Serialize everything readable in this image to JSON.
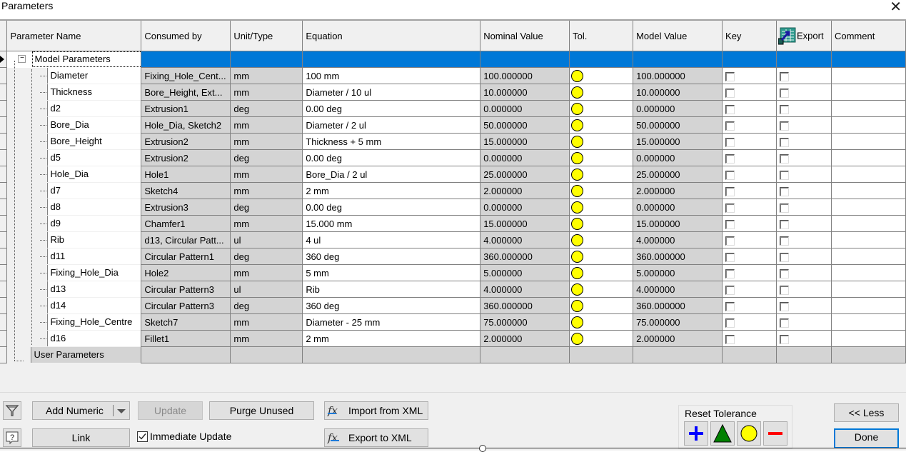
{
  "window": {
    "title": "Parameters",
    "close_icon": "close-icon"
  },
  "table": {
    "columns": [
      "Parameter Name",
      "Consumed by",
      "Unit/Type",
      "Equation",
      "Nominal Value",
      "Tol.",
      "Model Value",
      "Key",
      "Export",
      "Comment"
    ],
    "export_header_icon": "spreadsheet-export-icon",
    "groups": {
      "model": "Model Parameters",
      "user": "User Parameters"
    },
    "rows": [
      {
        "name": "Diameter",
        "consumed_by": "Fixing_Hole_Cent...",
        "unit": "mm",
        "equation": "100 mm",
        "nominal": "100.000000",
        "tol": "yellow-circle",
        "model": "100.000000",
        "key": false,
        "export": false,
        "comment": ""
      },
      {
        "name": "Thickness",
        "consumed_by": "Bore_Height, Ext...",
        "unit": "mm",
        "equation": "Diameter / 10 ul",
        "nominal": "10.000000",
        "tol": "yellow-circle",
        "model": "10.000000",
        "key": false,
        "export": false,
        "comment": ""
      },
      {
        "name": "d2",
        "consumed_by": "Extrusion1",
        "unit": "deg",
        "equation": "0.00 deg",
        "nominal": "0.000000",
        "tol": "yellow-circle",
        "model": "0.000000",
        "key": false,
        "export": false,
        "comment": ""
      },
      {
        "name": "Bore_Dia",
        "consumed_by": "Hole_Dia, Sketch2",
        "unit": "mm",
        "equation": "Diameter / 2 ul",
        "nominal": "50.000000",
        "tol": "yellow-circle",
        "model": "50.000000",
        "key": false,
        "export": false,
        "comment": ""
      },
      {
        "name": "Bore_Height",
        "consumed_by": "Extrusion2",
        "unit": "mm",
        "equation": "Thickness + 5 mm",
        "nominal": "15.000000",
        "tol": "yellow-circle",
        "model": "15.000000",
        "key": false,
        "export": false,
        "comment": ""
      },
      {
        "name": "d5",
        "consumed_by": "Extrusion2",
        "unit": "deg",
        "equation": "0.00 deg",
        "nominal": "0.000000",
        "tol": "yellow-circle",
        "model": "0.000000",
        "key": false,
        "export": false,
        "comment": ""
      },
      {
        "name": "Hole_Dia",
        "consumed_by": "Hole1",
        "unit": "mm",
        "equation": "Bore_Dia / 2 ul",
        "nominal": "25.000000",
        "tol": "yellow-circle",
        "model": "25.000000",
        "key": false,
        "export": false,
        "comment": ""
      },
      {
        "name": "d7",
        "consumed_by": "Sketch4",
        "unit": "mm",
        "equation": "2 mm",
        "nominal": "2.000000",
        "tol": "yellow-circle",
        "model": "2.000000",
        "key": false,
        "export": false,
        "comment": ""
      },
      {
        "name": "d8",
        "consumed_by": "Extrusion3",
        "unit": "deg",
        "equation": "0.00 deg",
        "nominal": "0.000000",
        "tol": "yellow-circle",
        "model": "0.000000",
        "key": false,
        "export": false,
        "comment": ""
      },
      {
        "name": "d9",
        "consumed_by": "Chamfer1",
        "unit": "mm",
        "equation": "15.000 mm",
        "nominal": "15.000000",
        "tol": "yellow-circle",
        "model": "15.000000",
        "key": false,
        "export": false,
        "comment": ""
      },
      {
        "name": "Rib",
        "consumed_by": "d13, Circular Patt...",
        "unit": "ul",
        "equation": "4 ul",
        "nominal": "4.000000",
        "tol": "yellow-circle",
        "model": "4.000000",
        "key": false,
        "export": false,
        "comment": ""
      },
      {
        "name": "d11",
        "consumed_by": "Circular Pattern1",
        "unit": "deg",
        "equation": "360 deg",
        "nominal": "360.000000",
        "tol": "yellow-circle",
        "model": "360.000000",
        "key": false,
        "export": false,
        "comment": ""
      },
      {
        "name": "Fixing_Hole_Dia",
        "consumed_by": "Hole2",
        "unit": "mm",
        "equation": "5 mm",
        "nominal": "5.000000",
        "tol": "yellow-circle",
        "model": "5.000000",
        "key": false,
        "export": false,
        "comment": ""
      },
      {
        "name": "d13",
        "consumed_by": "Circular Pattern3",
        "unit": "ul",
        "equation": "Rib",
        "nominal": "4.000000",
        "tol": "yellow-circle",
        "model": "4.000000",
        "key": false,
        "export": false,
        "comment": ""
      },
      {
        "name": "d14",
        "consumed_by": "Circular Pattern3",
        "unit": "deg",
        "equation": "360 deg",
        "nominal": "360.000000",
        "tol": "yellow-circle",
        "model": "360.000000",
        "key": false,
        "export": false,
        "comment": ""
      },
      {
        "name": "Fixing_Hole_Centre",
        "consumed_by": "Sketch7",
        "unit": "mm",
        "equation": "Diameter - 25 mm",
        "nominal": "75.000000",
        "tol": "yellow-circle",
        "model": "75.000000",
        "key": false,
        "export": false,
        "comment": ""
      },
      {
        "name": "d16",
        "consumed_by": "Fillet1",
        "unit": "mm",
        "equation": "2 mm",
        "nominal": "2.000000",
        "tol": "yellow-circle",
        "model": "2.000000",
        "key": false,
        "export": false,
        "comment": ""
      }
    ]
  },
  "toolbar": {
    "filter_icon": "filter-icon",
    "help_icon": "help-icon",
    "add_numeric": "Add Numeric",
    "update": "Update",
    "purge_unused": "Purge Unused",
    "link": "Link",
    "immediate_update": "Immediate Update",
    "immediate_update_checked": true,
    "import_xml": "Import from XML",
    "export_xml": "Export to XML",
    "fx_glyph": "fx",
    "reset_tolerance": {
      "label": "Reset Tolerance",
      "buttons": [
        "upper",
        "median",
        "nominal",
        "lower"
      ]
    },
    "less": "<< Less",
    "done": "Done"
  },
  "colors": {
    "selection": "#0078d7",
    "readonly_cell": "#d4d4d4",
    "tol_yellow": "#ffff00",
    "tol_green": "#008000",
    "plus_blue": "#0000ff",
    "minus_red": "#ff0000"
  }
}
